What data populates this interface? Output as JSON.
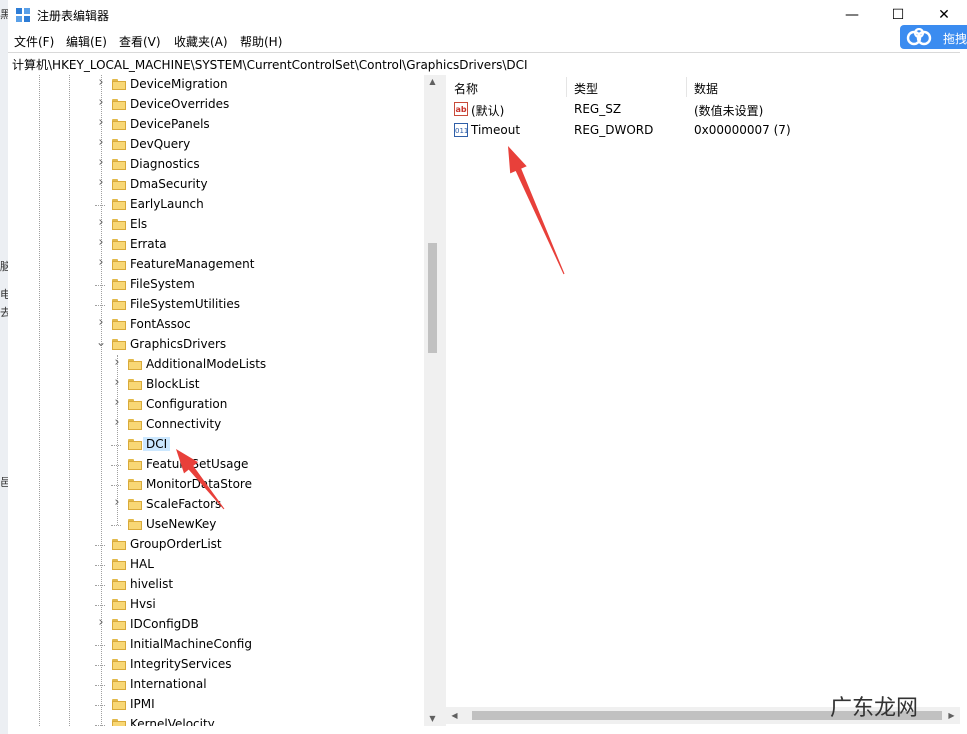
{
  "window": {
    "title": "注册表编辑器",
    "controls": {
      "minimize": "—",
      "maximize": "☐",
      "close": "✕"
    }
  },
  "menu": [
    "文件(F)",
    "编辑(E)",
    "查看(V)",
    "收藏夹(A)",
    "帮助(H)"
  ],
  "address": "计算机\\HKEY_LOCAL_MACHINE\\SYSTEM\\CurrentControlSet\\Control\\GraphicsDrivers\\DCI",
  "tree": {
    "items": [
      {
        "label": "DeviceMigration",
        "level": 1,
        "expander": true
      },
      {
        "label": "DeviceOverrides",
        "level": 1,
        "expander": true
      },
      {
        "label": "DevicePanels",
        "level": 1,
        "expander": true
      },
      {
        "label": "DevQuery",
        "level": 1,
        "expander": true
      },
      {
        "label": "Diagnostics",
        "level": 1,
        "expander": true
      },
      {
        "label": "DmaSecurity",
        "level": 1,
        "expander": true
      },
      {
        "label": "EarlyLaunch",
        "level": 1,
        "expander": false
      },
      {
        "label": "Els",
        "level": 1,
        "expander": true
      },
      {
        "label": "Errata",
        "level": 1,
        "expander": true
      },
      {
        "label": "FeatureManagement",
        "level": 1,
        "expander": true
      },
      {
        "label": "FileSystem",
        "level": 1,
        "expander": false
      },
      {
        "label": "FileSystemUtilities",
        "level": 1,
        "expander": false
      },
      {
        "label": "FontAssoc",
        "level": 1,
        "expander": true
      },
      {
        "label": "GraphicsDrivers",
        "level": 1,
        "expander": "open"
      },
      {
        "label": "AdditionalModeLists",
        "level": 2,
        "expander": true
      },
      {
        "label": "BlockList",
        "level": 2,
        "expander": true
      },
      {
        "label": "Configuration",
        "level": 2,
        "expander": true
      },
      {
        "label": "Connectivity",
        "level": 2,
        "expander": true
      },
      {
        "label": "DCI",
        "level": 2,
        "expander": false,
        "selected": true
      },
      {
        "label": "FeatureSetUsage",
        "level": 2,
        "expander": false
      },
      {
        "label": "MonitorDataStore",
        "level": 2,
        "expander": false
      },
      {
        "label": "ScaleFactors",
        "level": 2,
        "expander": true
      },
      {
        "label": "UseNewKey",
        "level": 2,
        "expander": false
      },
      {
        "label": "GroupOrderList",
        "level": 1,
        "expander": false
      },
      {
        "label": "HAL",
        "level": 1,
        "expander": false
      },
      {
        "label": "hivelist",
        "level": 1,
        "expander": false
      },
      {
        "label": "Hvsi",
        "level": 1,
        "expander": false
      },
      {
        "label": "IDConfigDB",
        "level": 1,
        "expander": true
      },
      {
        "label": "InitialMachineConfig",
        "level": 1,
        "expander": false
      },
      {
        "label": "IntegrityServices",
        "level": 1,
        "expander": false
      },
      {
        "label": "International",
        "level": 1,
        "expander": false
      },
      {
        "label": "IPMI",
        "level": 1,
        "expander": false
      },
      {
        "label": "KernelVelocity",
        "level": 1,
        "expander": false
      }
    ]
  },
  "list": {
    "columns": [
      "名称",
      "类型",
      "数据"
    ],
    "rows": [
      {
        "name": "(默认)",
        "type": "REG_SZ",
        "data": "(数值未设置)",
        "icon": "ab"
      },
      {
        "name": "Timeout",
        "type": "REG_DWORD",
        "data": "0x00000007 (7)",
        "icon": "011"
      }
    ]
  },
  "overlay": {
    "baidu_label": "拖拽",
    "watermark": "广东龙网",
    "arrow_color": "#e8403a"
  }
}
